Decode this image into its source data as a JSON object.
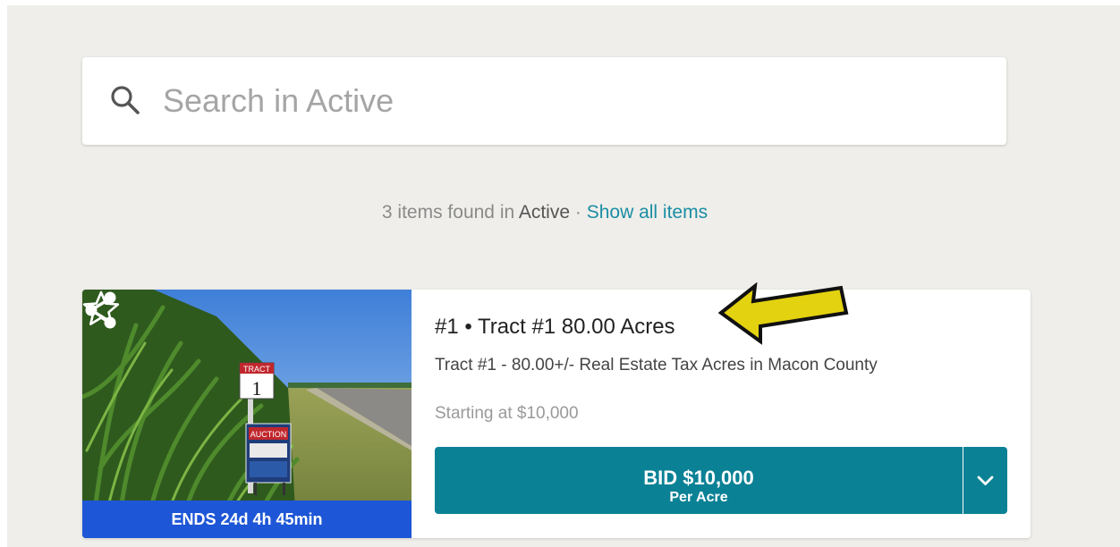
{
  "search": {
    "placeholder": "Search in Active",
    "icon": "search-icon"
  },
  "results": {
    "prefix": "3 items found in ",
    "category": "Active",
    "separator": " · ",
    "show_all_label": "Show all items"
  },
  "lot": {
    "title": "#1 • Tract #1 80.00 Acres",
    "description": "Tract #1 - 80.00+/- Real Estate Tax Acres in Macon County",
    "starting_text": "Starting at $10,000",
    "ends_text": "ENDS 24d 4h 45min",
    "bid_label": "BID $10,000",
    "bid_sublabel": "Per Acre",
    "photo_sign_text": "TRACT",
    "photo_sign_number": "1",
    "photo_banner_text": "AUCTION"
  },
  "colors": {
    "background": "#efeeea",
    "accent_teal": "#0b8195",
    "link": "#1a8da4",
    "ends_bar": "#1d56d6",
    "annotation_arrow": "#e3d20f"
  }
}
